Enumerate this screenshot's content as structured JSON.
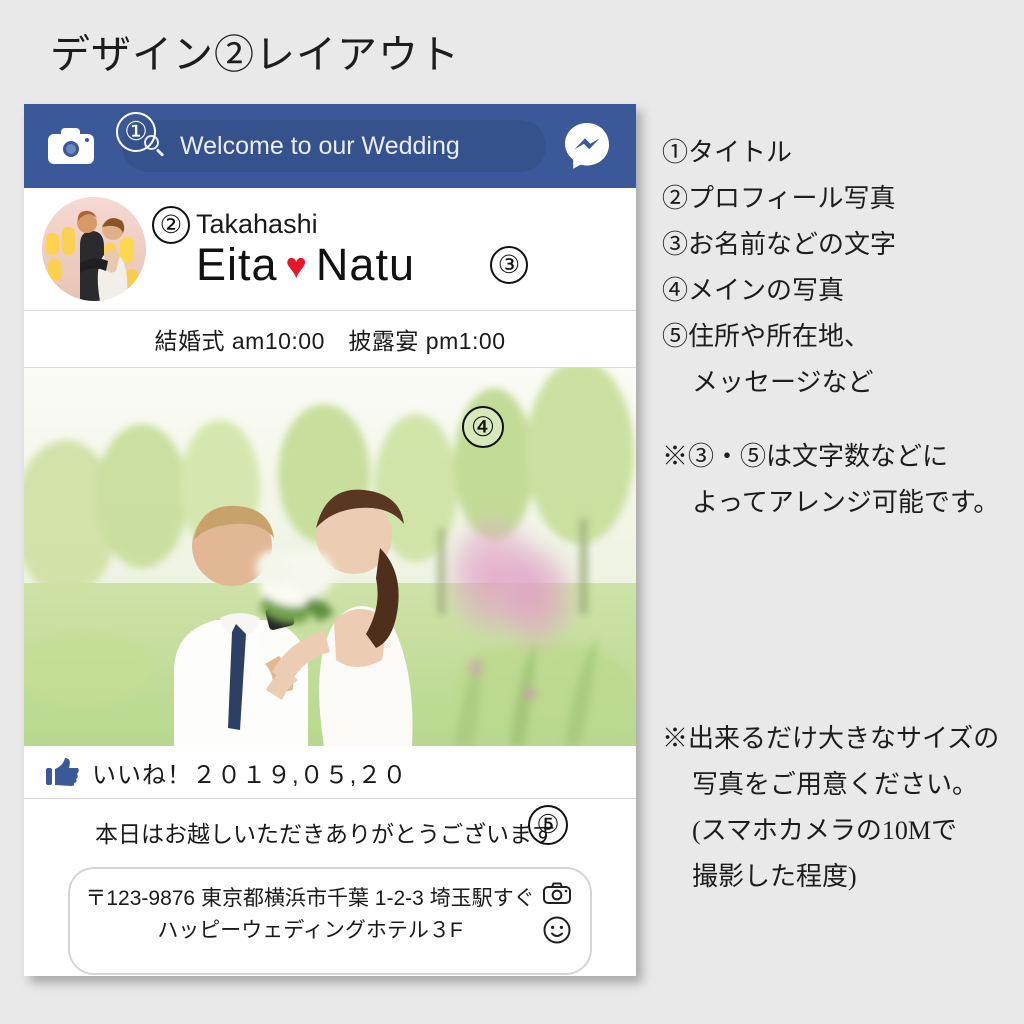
{
  "page": {
    "title": "デザイン②レイアウト",
    "background_color": "#e9e9e9"
  },
  "card": {
    "header": {
      "camera_icon": "camera-icon",
      "marker": "①",
      "search_placeholder": "Welcome to our Wedding",
      "search_icon": "search-icon",
      "messenger_icon": "messenger-icon",
      "bar_color": "#3b5998",
      "pill_color": "#35528c"
    },
    "profile": {
      "marker_photo": "②",
      "marker_text": "③",
      "surname": "Takahashi",
      "name_left": "Eita",
      "heart": "♥",
      "name_right": "Natu",
      "heart_color": "#e4172b",
      "avatar_icon": "wedding-cake-topper-photo"
    },
    "schedule": {
      "text": "結婚式 am10:00　披露宴 pm1:00"
    },
    "main_photo": {
      "marker": "④",
      "alt": "outdoor-wedding-couple-photo"
    },
    "like_row": {
      "thumb_icon": "thumbs-up-icon",
      "text": "いいね！２０１９,０５,２０"
    },
    "message": {
      "marker": "⑤",
      "greeting": "本日はお越しいただきありがとうございます",
      "address_line_1": "〒123-9876 東京都横浜市千葉 1-2-3 埼玉駅すぐ",
      "address_line_2": "ハッピーウェディングホテル３F",
      "icons": [
        "camera-icon",
        "smiley-face-icon"
      ]
    }
  },
  "legend": {
    "items": [
      "①タイトル",
      "②プロフィール写真",
      "③お名前などの文字",
      "④メインの写真",
      "⑤住所や所在地、",
      "メッセージなど"
    ]
  },
  "notes": {
    "note_1_line_1": "※③・⑤は文字数などに",
    "note_1_line_2": "よってアレンジ可能です。",
    "note_2_line_1": "※出来るだけ大きなサイズの",
    "note_2_line_2": "写真をご用意ください。",
    "note_2_line_3": "(スマホカメラの10Mで",
    "note_2_line_4": "撮影した程度)"
  }
}
